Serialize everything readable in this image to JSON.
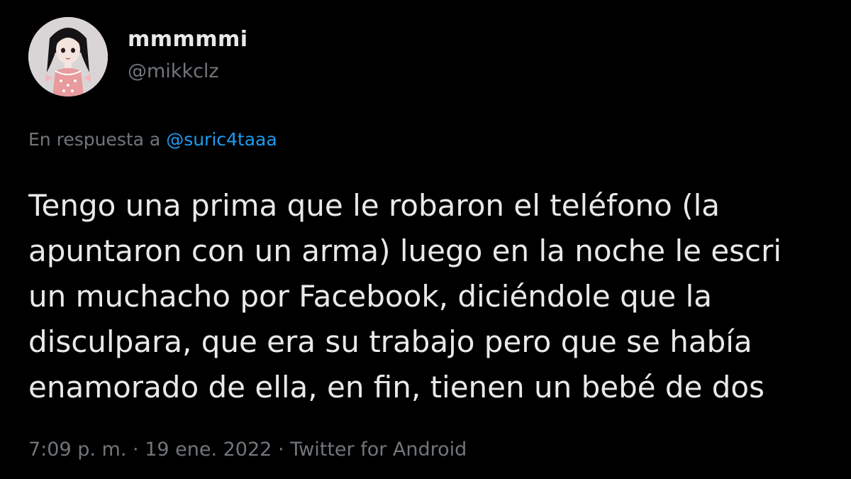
{
  "author": {
    "display_name": "mmmmmi",
    "handle": "@mikkclz",
    "avatar_icon": "profile-avatar-illustration"
  },
  "reply": {
    "prefix": "En respuesta a",
    "mention": "@suric4taaa"
  },
  "tweet": {
    "lines": [
      "Tengo una prima que le robaron el teléfono (la",
      "apuntaron con un arma) luego en la noche le escri",
      "un muchacho por Facebook, diciéndole que la",
      "disculpara, que era su trabajo pero que se había",
      "enamorado de ella, en fin, tienen un bebé de dos"
    ]
  },
  "meta": {
    "time": "7:09 p. m.",
    "separator": "·",
    "date": "19 ene. 2022",
    "source": "Twitter for Android"
  },
  "colors": {
    "background": "#000000",
    "text": "#e7e9ea",
    "secondary": "#71767b",
    "link": "#1d9bf0"
  }
}
